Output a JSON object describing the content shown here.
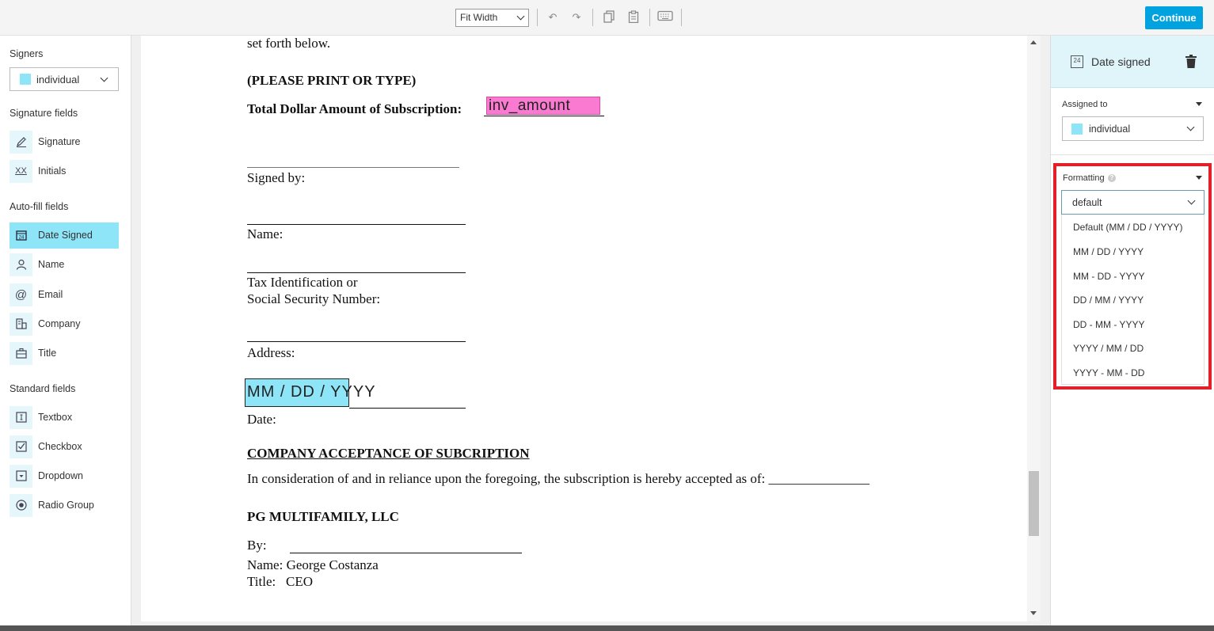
{
  "toolbar": {
    "zoom_value": "Fit Width",
    "continue_label": "Continue"
  },
  "left_panel": {
    "signers_heading": "Signers",
    "signer_selected": "individual",
    "signature_heading": "Signature fields",
    "signature_fields": [
      {
        "label": "Signature",
        "icon": "pen-icon"
      },
      {
        "label": "Initials",
        "icon": "initials-icon"
      }
    ],
    "autofill_heading": "Auto-fill fields",
    "autofill_fields": [
      {
        "label": "Date Signed",
        "icon": "calendar-icon",
        "active": true
      },
      {
        "label": "Name",
        "icon": "person-icon"
      },
      {
        "label": "Email",
        "icon": "at-icon"
      },
      {
        "label": "Company",
        "icon": "building-icon"
      },
      {
        "label": "Title",
        "icon": "briefcase-icon"
      }
    ],
    "standard_heading": "Standard fields",
    "standard_fields": [
      {
        "label": "Textbox",
        "icon": "textbox-icon"
      },
      {
        "label": "Checkbox",
        "icon": "checkbox-icon"
      },
      {
        "label": "Dropdown",
        "icon": "dropdown-icon"
      },
      {
        "label": "Radio Group",
        "icon": "radio-icon"
      }
    ]
  },
  "document": {
    "line_setforth": "set forth below.",
    "line_print": "(PLEASE PRINT OR TYPE)",
    "line_total": "Total Dollar Amount of Subscription:",
    "inv_amount_field": "inv_amount",
    "signed_by": "Signed by:",
    "name_label": "Name:",
    "tax_line1": "Tax Identification or",
    "tax_line2": "Social Security Number:",
    "address_label": "Address:",
    "date_field_placeholder": "MM / DD / YYYY",
    "date_label": "Date:",
    "acceptance_heading": "COMPANY ACCEPTANCE OF SUBCRIPTION",
    "acceptance_text": "In consideration of and in reliance upon the foregoing, the subscription is hereby accepted as of: _______________",
    "company_name": "PG MULTIFAMILY, LLC",
    "by_label": "By:",
    "name_line": "Name: George Costanza",
    "title_line": "Title:   CEO"
  },
  "right_panel": {
    "field_title": "Date signed",
    "assigned_label": "Assigned to",
    "assigned_value": "individual",
    "formatting_label": "Formatting",
    "formatting_value": "default",
    "format_options": [
      "Default (MM / DD / YYYY)",
      "MM / DD / YYYY",
      "MM - DD - YYYY",
      "DD / MM / YYYY",
      "DD - MM - YYYY",
      "YYYY / MM / DD",
      "YYYY - MM - DD"
    ]
  },
  "colors": {
    "accent": "#00a3e0",
    "signer_swatch": "#8ee5f7",
    "inv_field": "#f97ad0",
    "highlight": "#e3202a"
  }
}
